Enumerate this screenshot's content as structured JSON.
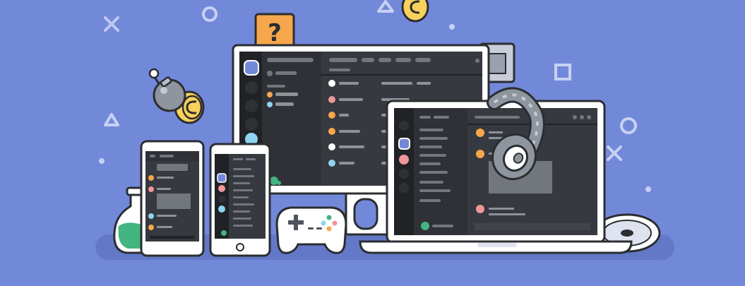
{
  "illustration": {
    "background_color": "#7289da",
    "outline_color": "#ffffff",
    "screen_color": "#2f3136",
    "sidebar_color": "#202225",
    "accent_colors": {
      "blurple": "#7289da",
      "orange": "#f6a74b",
      "green": "#43b581",
      "pink": "#f0969a",
      "light_blue": "#8ed3f0",
      "coin_yellow": "#f9d15b"
    },
    "question_block_text": "?",
    "icons": [
      "x-shape-icon",
      "circle-shape-icon",
      "triangle-shape-icon",
      "square-shape-icon",
      "question-block-icon",
      "coin-icon",
      "bomb-icon",
      "potion-flask-icon",
      "gamepad-icon",
      "headphones-icon",
      "disc-icon",
      "monitor-icon",
      "laptop-icon",
      "phone-icon"
    ]
  }
}
